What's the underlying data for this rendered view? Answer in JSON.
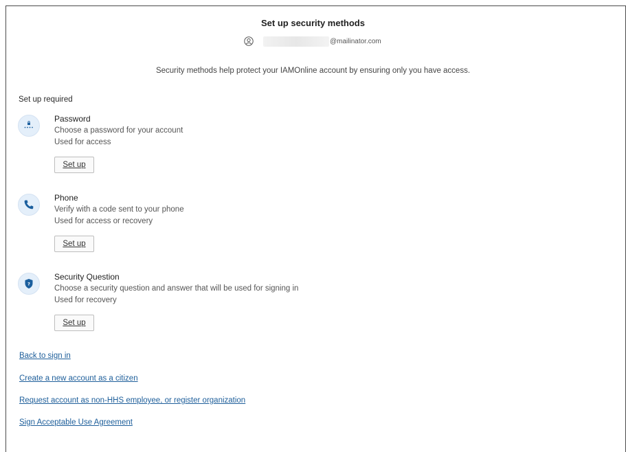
{
  "title": "Set up security methods",
  "user": {
    "email_domain": "@mailinator.com"
  },
  "description": "Security methods help protect your IAMOnline account by ensuring only you have access.",
  "section_label": "Set up required",
  "methods": [
    {
      "name": "Password",
      "description": "Choose a password for your account",
      "usage": "Used for access",
      "button": "Set up",
      "icon": "password-lock-icon"
    },
    {
      "name": "Phone",
      "description": "Verify with a code sent to your phone",
      "usage": "Used for access or recovery",
      "button": "Set up",
      "icon": "phone-icon"
    },
    {
      "name": "Security Question",
      "description": "Choose a security question and answer that will be used for signing in",
      "usage": "Used for recovery",
      "button": "Set up",
      "icon": "shield-question-icon"
    }
  ],
  "links": [
    "Back to sign in",
    "Create a new account as a citizen",
    "Request account as non-HHS employee, or register organization",
    "Sign Acceptable Use Agreement"
  ],
  "colors": {
    "link": "#1d5e9a",
    "icon_bg": "#e4effa",
    "icon_fg": "#1b5f9e"
  }
}
